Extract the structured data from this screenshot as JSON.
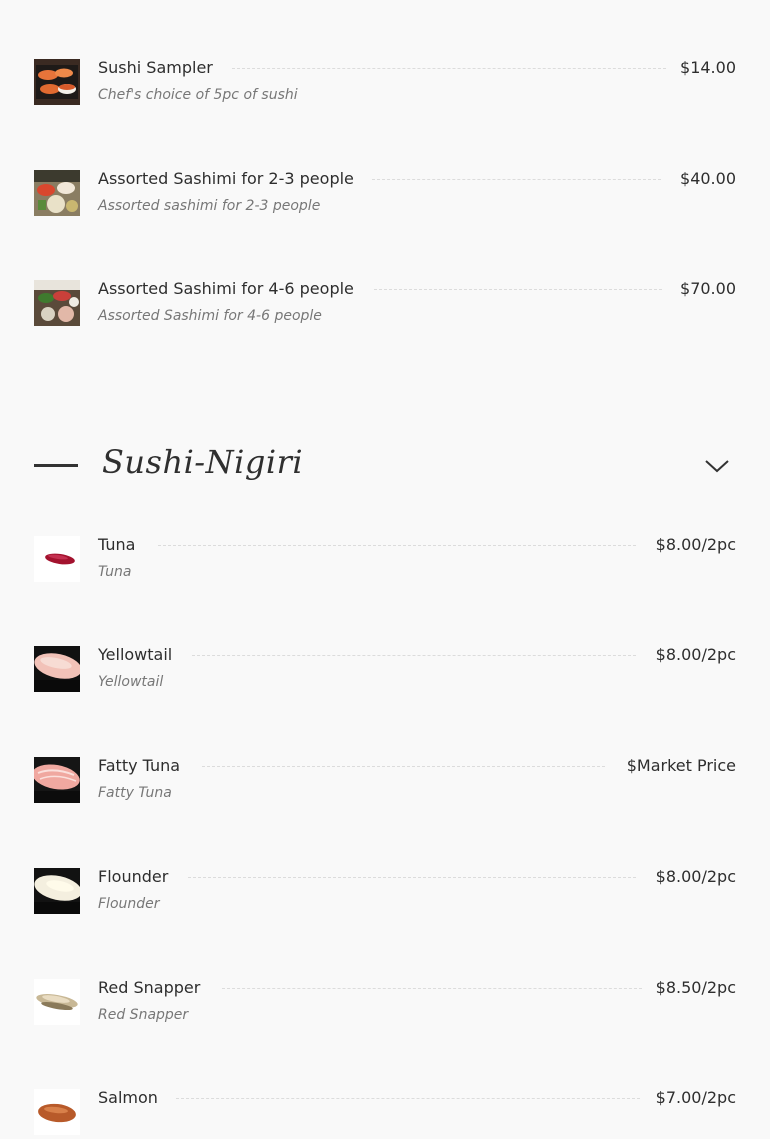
{
  "platters": [
    {
      "name": "Sushi Sampler",
      "desc": "Chef's choice of 5pc of sushi",
      "price": "$14.00",
      "icon": "sushi-sampler-photo"
    },
    {
      "name": "Assorted Sashimi for 2-3 people",
      "desc": "Assorted sashimi for 2-3 people",
      "price": "$40.00",
      "icon": "sashimi-platter-photo"
    },
    {
      "name": "Assorted Sashimi for 4-6 people",
      "desc": "Assorted Sashimi for 4-6 people",
      "price": "$70.00",
      "icon": "sashimi-platter-large-photo"
    }
  ],
  "section": {
    "title": "Sushi-Nigiri",
    "toggle_icon": "chevron-down-icon"
  },
  "nigiri": [
    {
      "name": "Tuna",
      "desc": "Tuna",
      "price": "$8.00/2pc",
      "icon": "tuna-nigiri-photo"
    },
    {
      "name": "Yellowtail",
      "desc": "Yellowtail",
      "price": "$8.00/2pc",
      "icon": "yellowtail-nigiri-photo"
    },
    {
      "name": "Fatty Tuna",
      "desc": "Fatty Tuna",
      "price": "$Market Price",
      "icon": "fatty-tuna-nigiri-photo"
    },
    {
      "name": "Flounder",
      "desc": "Flounder",
      "price": "$8.00/2pc",
      "icon": "flounder-nigiri-photo"
    },
    {
      "name": "Red Snapper",
      "desc": "Red Snapper",
      "price": "$8.50/2pc",
      "icon": "red-snapper-nigiri-photo"
    },
    {
      "name": "Salmon",
      "desc": "",
      "price": "$7.00/2pc",
      "icon": "salmon-nigiri-photo"
    }
  ],
  "colors": {
    "background": "#f9f9f9",
    "text": "#2e2e2e",
    "muted": "#777777",
    "leader": "#dcdcdc"
  }
}
